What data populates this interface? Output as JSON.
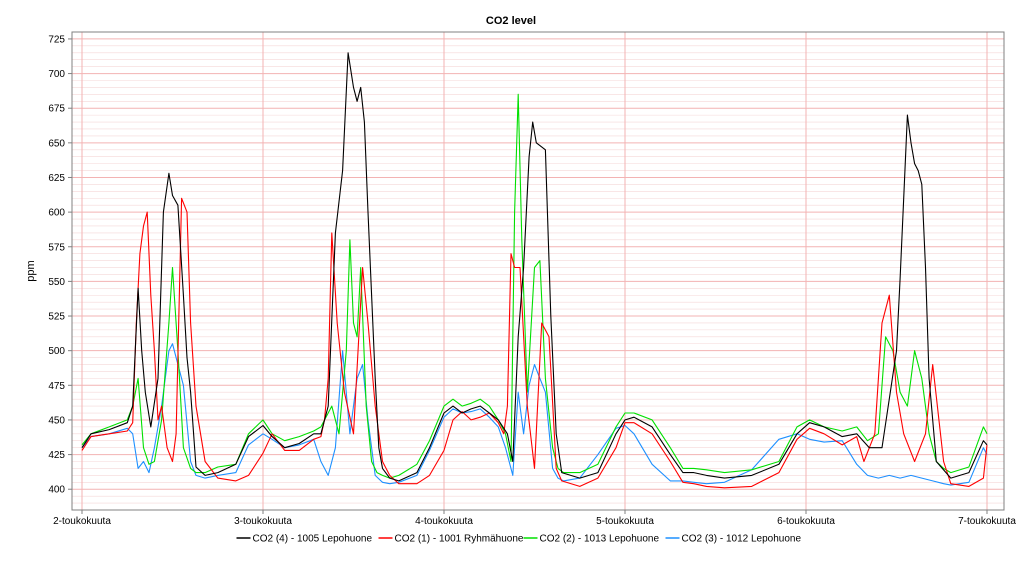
{
  "chart_data": {
    "type": "line",
    "title": "CO2 level",
    "ylabel": "ppm",
    "xlabel": "",
    "ylim": [
      385,
      730
    ],
    "yticks": [
      400,
      425,
      450,
      475,
      500,
      525,
      550,
      575,
      600,
      625,
      650,
      675,
      700,
      725
    ],
    "ytick_labels": [
      "400",
      "425",
      "450",
      "475",
      "500",
      "525",
      "550",
      "575",
      "600",
      "625",
      "650",
      "675",
      "700",
      "725"
    ],
    "xlim": [
      0,
      5
    ],
    "xticks": [
      0,
      1,
      2,
      3,
      4,
      5
    ],
    "xtick_labels": [
      "2-toukokuuta",
      "3-toukokuuta",
      "4-toukokuuta",
      "5-toukokuuta",
      "6-toukokuuta",
      "7-toukokuuta"
    ],
    "grid": true,
    "legend": "bottom",
    "colors": {
      "background": "#ffffff",
      "plot_border": "#808080",
      "grid_major": "#f3b3b3",
      "grid_minor": "#f5d7d7"
    },
    "series": [
      {
        "name": "CO2  (4) - 1005 Lepohuone",
        "color": "#000000",
        "x": [
          0,
          0.05,
          0.15,
          0.25,
          0.28,
          0.31,
          0.33,
          0.35,
          0.38,
          0.42,
          0.45,
          0.48,
          0.5,
          0.53,
          0.56,
          0.58,
          0.6,
          0.63,
          0.68,
          0.75,
          0.85,
          0.92,
          1.0,
          1.05,
          1.12,
          1.2,
          1.28,
          1.32,
          1.36,
          1.4,
          1.44,
          1.47,
          1.5,
          1.52,
          1.54,
          1.56,
          1.58,
          1.6,
          1.62,
          1.64,
          1.66,
          1.7,
          1.75,
          1.85,
          1.92,
          2.0,
          2.05,
          2.1,
          2.15,
          2.2,
          2.25,
          2.3,
          2.35,
          2.38,
          2.41,
          2.44,
          2.47,
          2.49,
          2.51,
          2.53,
          2.56,
          2.59,
          2.62,
          2.65,
          2.75,
          2.85,
          2.95,
          3.0,
          3.05,
          3.15,
          3.25,
          3.32,
          3.38,
          3.45,
          3.55,
          3.7,
          3.85,
          3.95,
          4.02,
          4.1,
          4.2,
          4.28,
          4.35,
          4.42,
          4.5,
          4.52,
          4.54,
          4.56,
          4.58,
          4.6,
          4.62,
          4.64,
          4.66,
          4.68,
          4.72,
          4.8,
          4.9,
          4.98,
          5.0
        ],
        "y": [
          430,
          440,
          443,
          448,
          460,
          545,
          500,
          470,
          445,
          480,
          600,
          628,
          612,
          605,
          540,
          495,
          470,
          416,
          410,
          412,
          418,
          438,
          446,
          438,
          430,
          433,
          440,
          440,
          460,
          585,
          630,
          715,
          690,
          680,
          690,
          665,
          600,
          540,
          480,
          430,
          415,
          408,
          406,
          412,
          430,
          455,
          460,
          455,
          458,
          460,
          455,
          450,
          440,
          420,
          510,
          560,
          640,
          665,
          650,
          648,
          645,
          525,
          440,
          412,
          408,
          412,
          440,
          450,
          452,
          445,
          425,
          412,
          412,
          410,
          408,
          410,
          418,
          440,
          448,
          445,
          438,
          440,
          430,
          430,
          500,
          552,
          610,
          670,
          650,
          635,
          630,
          620,
          560,
          480,
          420,
          408,
          412,
          435,
          432
        ]
      },
      {
        "name": "CO2 (1) - 1001 Ryhmähuone",
        "color": "#ff0000",
        "x": [
          0,
          0.05,
          0.15,
          0.25,
          0.28,
          0.3,
          0.32,
          0.34,
          0.36,
          0.38,
          0.4,
          0.42,
          0.44,
          0.47,
          0.5,
          0.52,
          0.55,
          0.58,
          0.6,
          0.63,
          0.68,
          0.75,
          0.85,
          0.92,
          1.0,
          1.05,
          1.12,
          1.2,
          1.28,
          1.32,
          1.34,
          1.36,
          1.38,
          1.41,
          1.45,
          1.5,
          1.55,
          1.58,
          1.62,
          1.66,
          1.7,
          1.75,
          1.85,
          1.92,
          2.0,
          2.05,
          2.1,
          2.15,
          2.2,
          2.25,
          2.3,
          2.33,
          2.35,
          2.37,
          2.39,
          2.42,
          2.46,
          2.5,
          2.54,
          2.58,
          2.62,
          2.65,
          2.75,
          2.85,
          2.95,
          3.0,
          3.05,
          3.15,
          3.25,
          3.32,
          3.38,
          3.45,
          3.55,
          3.7,
          3.85,
          3.95,
          4.02,
          4.1,
          4.2,
          4.28,
          4.32,
          4.38,
          4.42,
          4.46,
          4.5,
          4.54,
          4.6,
          4.66,
          4.7,
          4.76,
          4.8,
          4.9,
          4.98,
          5.0
        ],
        "y": [
          428,
          438,
          440,
          442,
          448,
          520,
          570,
          590,
          600,
          540,
          500,
          450,
          460,
          430,
          420,
          440,
          610,
          600,
          520,
          460,
          420,
          408,
          406,
          410,
          426,
          440,
          428,
          428,
          436,
          438,
          450,
          480,
          585,
          520,
          470,
          440,
          560,
          520,
          460,
          420,
          410,
          404,
          404,
          410,
          428,
          450,
          456,
          450,
          452,
          455,
          448,
          440,
          460,
          570,
          560,
          560,
          460,
          415,
          520,
          510,
          415,
          406,
          402,
          408,
          430,
          448,
          448,
          440,
          420,
          405,
          404,
          402,
          401,
          402,
          412,
          436,
          444,
          440,
          432,
          438,
          420,
          440,
          520,
          540,
          470,
          440,
          420,
          440,
          490,
          420,
          404,
          402,
          408,
          432
        ]
      },
      {
        "name": "CO2 (2) - 1013 Lepohuone",
        "color": "#00e000",
        "x": [
          0,
          0.05,
          0.15,
          0.25,
          0.28,
          0.31,
          0.34,
          0.37,
          0.4,
          0.44,
          0.48,
          0.5,
          0.53,
          0.56,
          0.6,
          0.63,
          0.68,
          0.75,
          0.85,
          0.92,
          1.0,
          1.05,
          1.12,
          1.2,
          1.28,
          1.32,
          1.38,
          1.42,
          1.46,
          1.48,
          1.5,
          1.52,
          1.54,
          1.57,
          1.6,
          1.63,
          1.66,
          1.7,
          1.75,
          1.85,
          1.92,
          2.0,
          2.05,
          2.1,
          2.15,
          2.2,
          2.25,
          2.3,
          2.34,
          2.37,
          2.39,
          2.41,
          2.43,
          2.46,
          2.5,
          2.53,
          2.56,
          2.6,
          2.63,
          2.66,
          2.75,
          2.85,
          2.95,
          3.0,
          3.05,
          3.15,
          3.25,
          3.32,
          3.38,
          3.45,
          3.55,
          3.7,
          3.85,
          3.95,
          4.02,
          4.1,
          4.2,
          4.28,
          4.34,
          4.4,
          4.44,
          4.48,
          4.52,
          4.56,
          4.6,
          4.64,
          4.68,
          4.72,
          4.76,
          4.8,
          4.9,
          4.98,
          5.0
        ],
        "y": [
          432,
          440,
          445,
          450,
          460,
          480,
          430,
          418,
          420,
          450,
          520,
          560,
          500,
          430,
          415,
          412,
          412,
          416,
          418,
          440,
          450,
          440,
          435,
          438,
          442,
          445,
          460,
          440,
          500,
          580,
          520,
          510,
          560,
          460,
          420,
          412,
          410,
          408,
          410,
          418,
          435,
          460,
          465,
          460,
          462,
          465,
          460,
          450,
          440,
          420,
          600,
          685,
          580,
          470,
          560,
          565,
          480,
          430,
          415,
          412,
          412,
          418,
          445,
          455,
          455,
          450,
          430,
          415,
          415,
          414,
          412,
          414,
          420,
          445,
          450,
          445,
          442,
          445,
          435,
          440,
          510,
          500,
          470,
          460,
          500,
          480,
          440,
          420,
          415,
          412,
          416,
          445,
          440
        ]
      },
      {
        "name": "CO2 (3) - 1012 Lepohuone",
        "color": "#1e90ff",
        "x": [
          0,
          0.05,
          0.15,
          0.25,
          0.28,
          0.31,
          0.34,
          0.37,
          0.4,
          0.44,
          0.48,
          0.5,
          0.53,
          0.56,
          0.6,
          0.63,
          0.68,
          0.75,
          0.85,
          0.92,
          1.0,
          1.05,
          1.12,
          1.2,
          1.28,
          1.32,
          1.36,
          1.4,
          1.44,
          1.48,
          1.52,
          1.55,
          1.58,
          1.62,
          1.66,
          1.7,
          1.75,
          1.85,
          1.92,
          2.0,
          2.05,
          2.1,
          2.15,
          2.2,
          2.25,
          2.3,
          2.34,
          2.38,
          2.41,
          2.44,
          2.47,
          2.5,
          2.53,
          2.56,
          2.6,
          2.63,
          2.66,
          2.75,
          2.85,
          2.95,
          3.0,
          3.05,
          3.15,
          3.25,
          3.32,
          3.38,
          3.45,
          3.55,
          3.7,
          3.85,
          3.95,
          4.02,
          4.1,
          4.2,
          4.28,
          4.34,
          4.4,
          4.46,
          4.52,
          4.58,
          4.64,
          4.7,
          4.76,
          4.8,
          4.9,
          4.98,
          5.0
        ],
        "y": [
          430,
          438,
          440,
          444,
          440,
          415,
          420,
          412,
          430,
          460,
          500,
          505,
          490,
          475,
          420,
          410,
          408,
          410,
          412,
          432,
          440,
          436,
          430,
          432,
          436,
          420,
          410,
          430,
          500,
          440,
          480,
          490,
          450,
          410,
          405,
          404,
          405,
          410,
          428,
          452,
          458,
          455,
          456,
          458,
          452,
          445,
          430,
          410,
          470,
          440,
          475,
          490,
          480,
          470,
          415,
          408,
          406,
          408,
          425,
          444,
          446,
          440,
          418,
          406,
          406,
          405,
          404,
          405,
          414,
          436,
          440,
          436,
          434,
          435,
          418,
          410,
          408,
          410,
          408,
          410,
          408,
          406,
          404,
          403,
          405,
          430,
          425
        ]
      }
    ]
  }
}
